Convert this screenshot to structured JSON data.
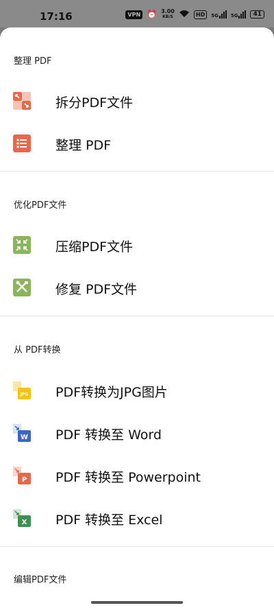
{
  "status_bar": {
    "time": "17:16",
    "vpn": "VPN",
    "speed_value": "3.00",
    "speed_unit": "KB/S",
    "hd": "HD",
    "net1": "5G",
    "net2": "5G",
    "battery": "41"
  },
  "sections": [
    {
      "title": "整理 PDF",
      "items": [
        {
          "label": "拆分PDF文件",
          "icon": "split-icon"
        },
        {
          "label": "整理 PDF",
          "icon": "list-icon"
        }
      ]
    },
    {
      "title": "优化PDF文件",
      "items": [
        {
          "label": "压缩PDF文件",
          "icon": "compress-icon"
        },
        {
          "label": "修复 PDF文件",
          "icon": "repair-tools-icon"
        }
      ]
    },
    {
      "title": "从 PDF转换",
      "items": [
        {
          "label": "PDF转换为JPG图片",
          "icon": "jpg-file-icon",
          "badge": "JPG"
        },
        {
          "label": "PDF 转换至 Word",
          "icon": "word-file-icon",
          "badge": "W"
        },
        {
          "label": "PDF 转换至 Powerpoint",
          "icon": "powerpoint-file-icon",
          "badge": "P"
        },
        {
          "label": "PDF 转换至 Excel",
          "icon": "excel-file-icon",
          "badge": "X"
        }
      ]
    },
    {
      "title": "编辑PDF文件",
      "items": []
    }
  ],
  "colors": {
    "organize": "#e8694a",
    "optimize": "#8bb55a",
    "jpg": "#f2c418",
    "word": "#3a66c4",
    "powerpoint": "#e8694a",
    "excel": "#3f8f4e"
  }
}
